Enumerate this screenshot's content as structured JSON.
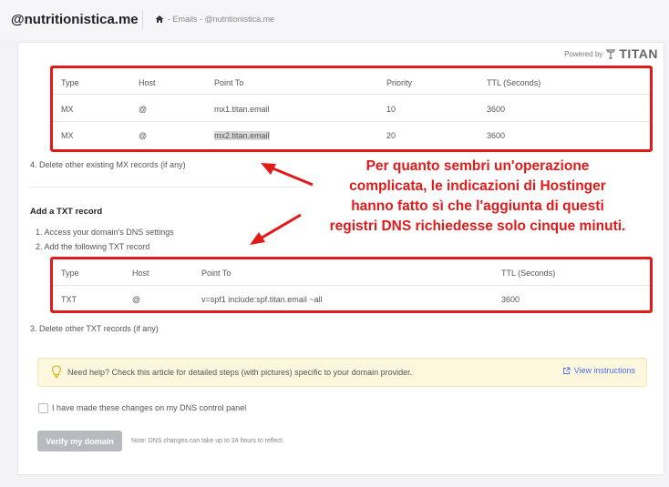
{
  "header": {
    "brand": "@nutritionistica.me",
    "breadcrumb": "- Emails - @nutritionistica.me"
  },
  "powered_by": {
    "label": "Powered by",
    "logo_text": "TITAN"
  },
  "mx_table": {
    "headers": [
      "Type",
      "Host",
      "Point To",
      "Priority",
      "TTL (Seconds)"
    ],
    "rows": [
      [
        "MX",
        "@",
        "mx1.titan.email",
        "10",
        "3600"
      ],
      [
        "MX",
        "@",
        "mx2.titan.email",
        "20",
        "3600"
      ]
    ]
  },
  "mx_step4": "4. Delete other existing MX records (if any)",
  "txt_section": {
    "title": "Add a TXT record",
    "step1": "1. Access your domain's DNS settings",
    "step2": "2. Add the following TXT record",
    "step3": "3. Delete other TXT records (if any)"
  },
  "txt_table": {
    "headers": [
      "Type",
      "Host",
      "Point To",
      "TTL (Seconds)"
    ],
    "rows": [
      [
        "TXT",
        "@",
        "v=spf1 include:spf.titan.email ~all",
        "3600"
      ]
    ]
  },
  "annotation": {
    "line1": "Per quanto sembri un'operazione",
    "line2": "complicata, le indicazioni di Hostinger",
    "line3": "hanno fatto sì che l'aggiunta di questi",
    "line4": "registri DNS richiedesse solo cinque minuti."
  },
  "help": {
    "text": "Need help? Check this article for detailed steps (with pictures) specific to your domain provider.",
    "link": "View instructions"
  },
  "confirm_label": "I have made these changes on my DNS control panel",
  "verify_button": "Verify my domain",
  "verify_note": "Note: DNS changes can take up to 24 hours to reflect.",
  "colors": {
    "annotation_red": "#e21a1a",
    "link_blue": "#4a6cf7",
    "help_bg": "#fdf8dd"
  }
}
